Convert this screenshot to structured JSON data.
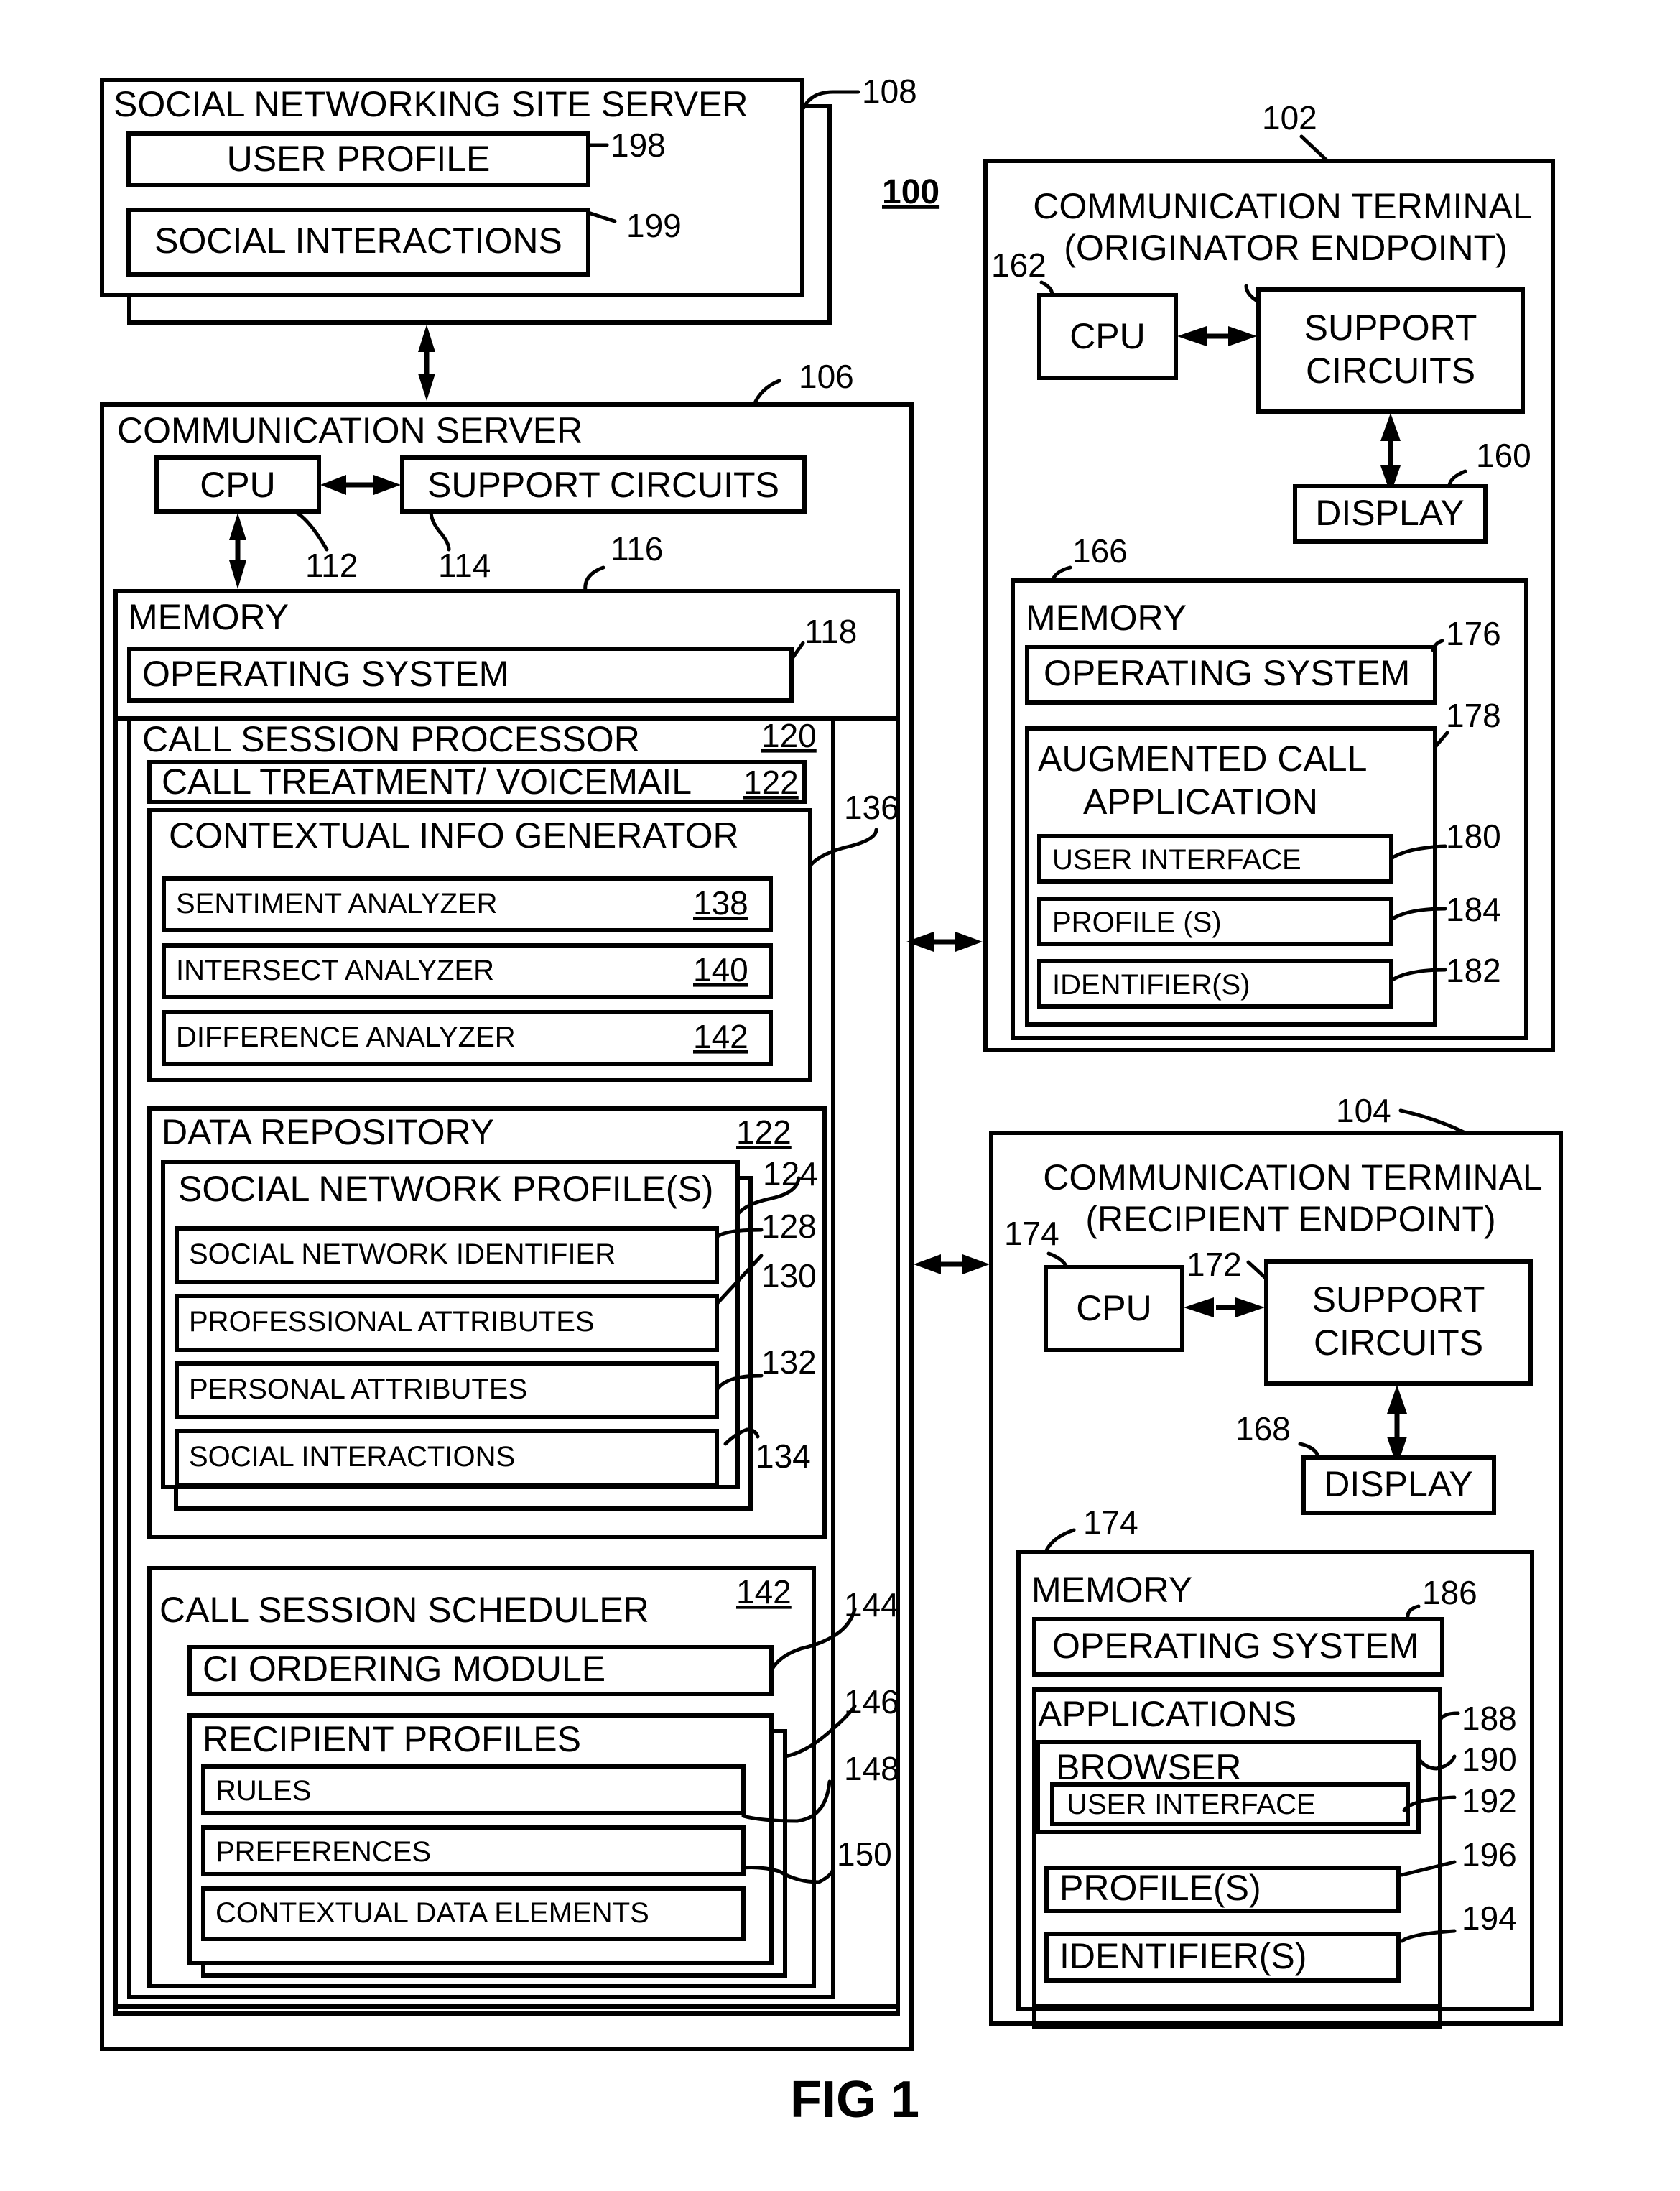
{
  "figure": {
    "system_ref": "100",
    "label": "FIG 1"
  },
  "sns_server": {
    "title": "SOCIAL NETWORKING SITE SERVER",
    "ref": "108",
    "user_profile": {
      "label": "USER PROFILE",
      "ref": "198"
    },
    "social_interactions": {
      "label": "SOCIAL INTERACTIONS",
      "ref": "199"
    }
  },
  "comm_server": {
    "title": "COMMUNICATION SERVER",
    "ref": "106",
    "cpu": {
      "label": "CPU",
      "ref": "112"
    },
    "support": {
      "label": "SUPPORT CIRCUITS",
      "ref": "114"
    },
    "memory": {
      "label": "MEMORY",
      "ref": "116",
      "os": {
        "label": "OPERATING SYSTEM",
        "ref": "118"
      },
      "csp": {
        "label": "CALL SESSION PROCESSOR",
        "ref": "120",
        "voicemail": {
          "label": "CALL TREATMENT/ VOICEMAIL",
          "ref": "122"
        },
        "cig": {
          "label": "CONTEXTUAL INFO GENERATOR",
          "ref": "136",
          "analyzers": [
            {
              "label": "SENTIMENT ANALYZER",
              "ref": "138"
            },
            {
              "label": "INTERSECT ANALYZER",
              "ref": "140"
            },
            {
              "label": "DIFFERENCE ANALYZER",
              "ref": "142"
            }
          ]
        },
        "repo": {
          "label": "DATA REPOSITORY",
          "ref": "122",
          "profiles": {
            "label": "SOCIAL NETWORK PROFILE(S)",
            "ref": "124",
            "items": [
              {
                "label": "SOCIAL NETWORK IDENTIFIER",
                "ref": "128"
              },
              {
                "label": "PROFESSIONAL ATTRIBUTES",
                "ref": "130"
              },
              {
                "label": "PERSONAL ATTRIBUTES",
                "ref": "132"
              },
              {
                "label": "SOCIAL INTERACTIONS",
                "ref": "134"
              }
            ]
          }
        },
        "scheduler": {
          "label": "CALL SESSION SCHEDULER",
          "ref": "142",
          "ordering": {
            "label": "CI ORDERING MODULE",
            "ref": "144"
          },
          "recipients": {
            "label": "RECIPIENT PROFILES",
            "ref": "146",
            "items": [
              {
                "label": "RULES",
                "ref": "148"
              },
              {
                "label": "PREFERENCES",
                "ref": "150"
              },
              {
                "label": "CONTEXTUAL DATA ELEMENTS"
              }
            ]
          }
        }
      }
    }
  },
  "originator": {
    "title_line1": "COMMUNICATION TERMINAL",
    "title_line2": "(ORIGINATOR ENDPOINT)",
    "ref": "102",
    "cpu": {
      "label": "CPU",
      "ref": "162"
    },
    "support": {
      "line1": "SUPPORT",
      "line2": "CIRCUITS"
    },
    "display": {
      "label": "DISPLAY",
      "ref": "160"
    },
    "memory": {
      "label": "MEMORY",
      "ref": "166",
      "os": {
        "label": "OPERATING SYSTEM",
        "ref": "176"
      },
      "app": {
        "line1": "AUGMENTED CALL",
        "line2": "APPLICATION",
        "ref": "178",
        "items": [
          {
            "label": "USER INTERFACE",
            "ref": "180"
          },
          {
            "label": "PROFILE (S)",
            "ref": "184"
          },
          {
            "label": "IDENTIFIER(S)",
            "ref": "182"
          }
        ]
      }
    }
  },
  "recipient": {
    "title_line1": "COMMUNICATION TERMINAL",
    "title_line2": "(RECIPIENT ENDPOINT)",
    "ref": "104",
    "cpu": {
      "label": "CPU",
      "ref": "174"
    },
    "support": {
      "line1": "SUPPORT",
      "line2": "CIRCUITS",
      "ref": "172"
    },
    "display": {
      "label": "DISPLAY",
      "ref": "168"
    },
    "memory": {
      "label": "MEMORY",
      "ref": "174",
      "os": {
        "label": "OPERATING SYSTEM",
        "ref": "186"
      },
      "apps": {
        "label": "APPLICATIONS",
        "ref": "188",
        "browser": {
          "label": "BROWSER",
          "ref": "190",
          "ui": {
            "label": "USER INTERFACE",
            "ref": "192"
          }
        },
        "profiles": {
          "label": "PROFILE(S)",
          "ref": "196"
        },
        "identifiers": {
          "label": "IDENTIFIER(S)",
          "ref": "194"
        }
      }
    }
  }
}
